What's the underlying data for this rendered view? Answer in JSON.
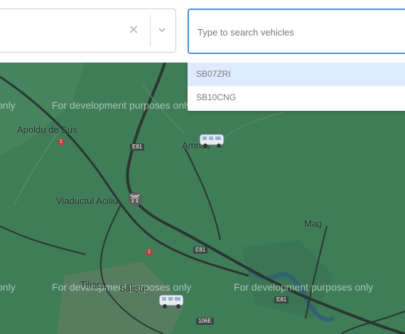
{
  "vehicle_select": {
    "clear_icon": "close-icon",
    "dropdown_icon": "chevron-down-icon"
  },
  "search": {
    "placeholder": "Type to search vehicles",
    "value": "",
    "options": [
      {
        "label": "SB07ZRI",
        "highlighted": true
      },
      {
        "label": "SB10CNG",
        "highlighted": false
      }
    ]
  },
  "map": {
    "watermark": "For development purposes only",
    "watermark_partial": "only",
    "places": [
      "Apoldu de Sus",
      "Amnaș",
      "Viaductul Aciliu",
      "Mag",
      "Tilișca",
      "Săliște"
    ],
    "route_badges": [
      "E81",
      "E81",
      "E81",
      "106E",
      "1",
      "1"
    ],
    "vehicle_icon": "campervan-icon",
    "colors": {
      "land": "#3f7d58",
      "road": "#2f3b36",
      "accent": "#4a90d9",
      "highlight": "#deebff"
    }
  }
}
